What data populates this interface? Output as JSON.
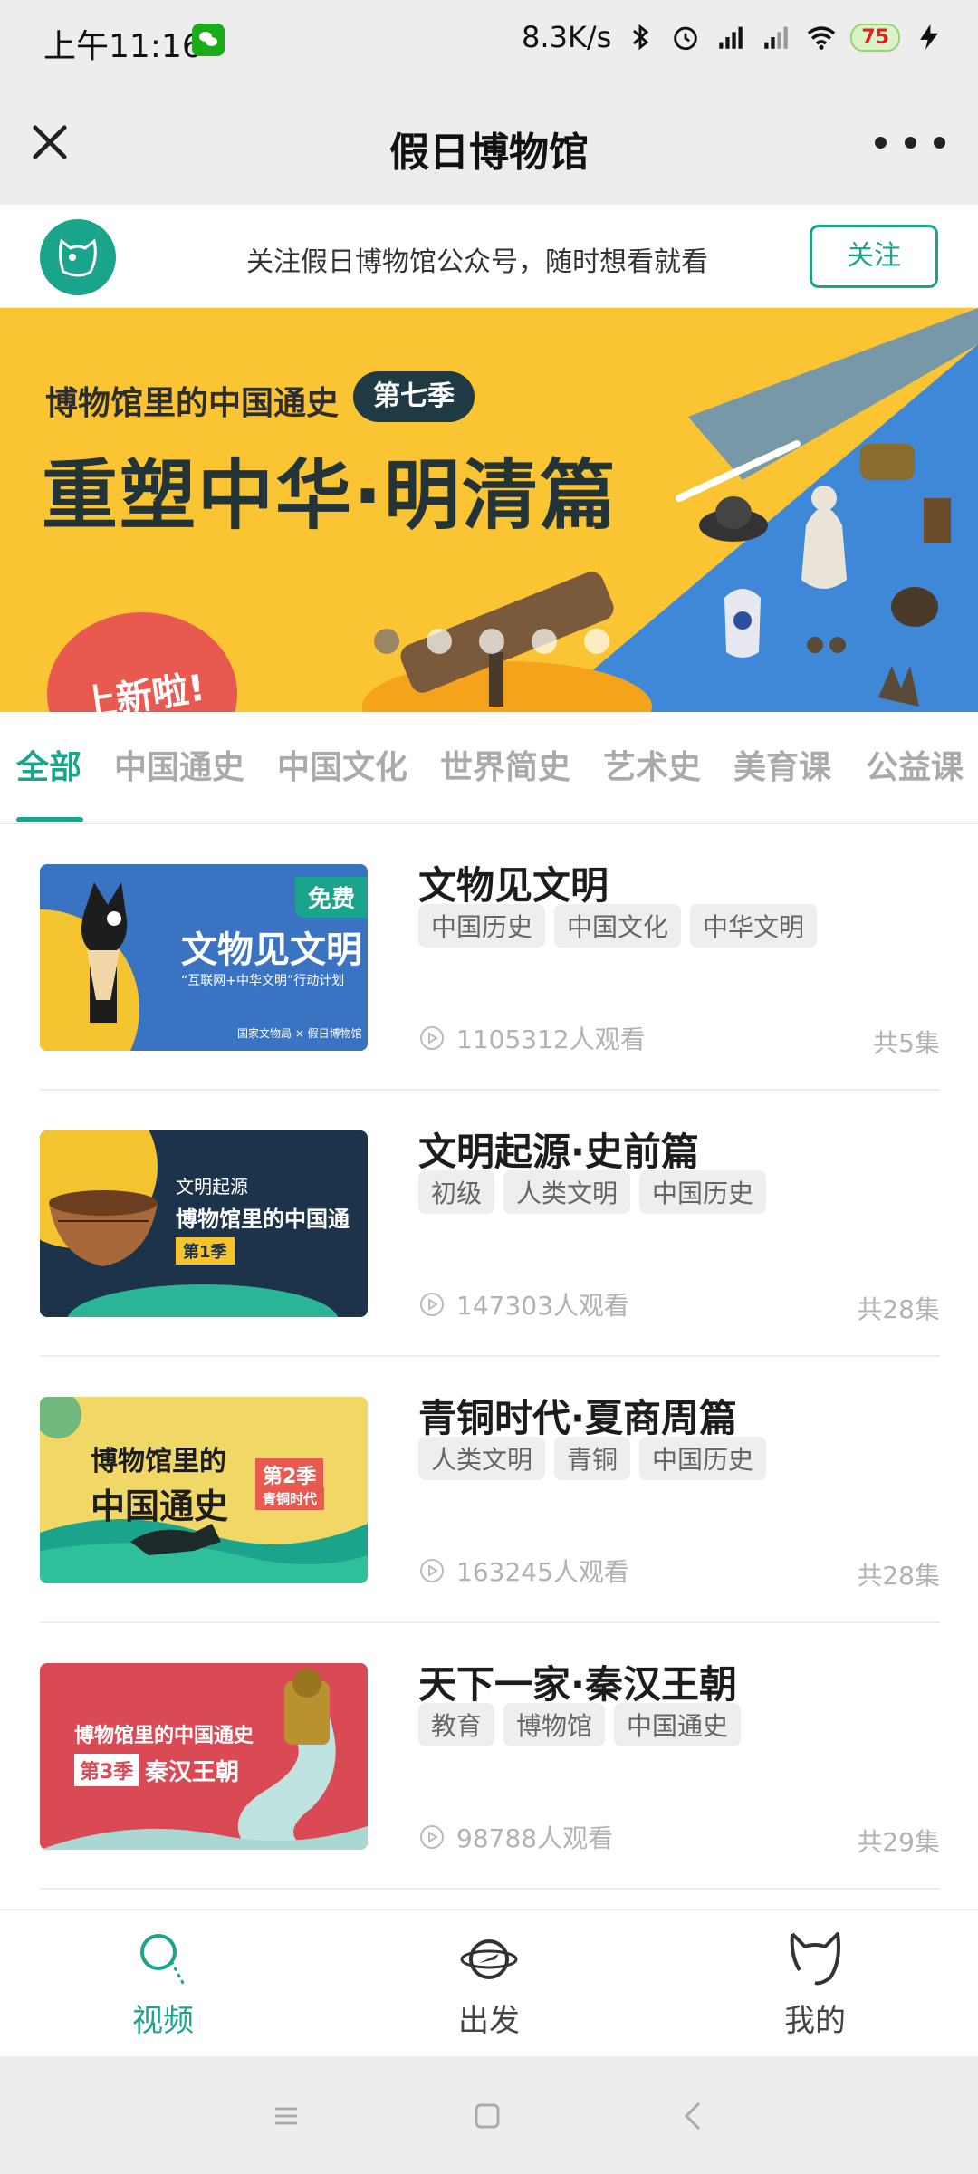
{
  "status_bar": {
    "time": "上午11:16",
    "speed": "8.3K/s",
    "battery": "75"
  },
  "header": {
    "title": "假日博物馆"
  },
  "follow_bar": {
    "text": "关注假日博物馆公众号，随时想看就看",
    "button": "关注"
  },
  "banner": {
    "subtitle": "博物馆里的中国通史",
    "season": "第七季",
    "title": "重塑中华·明清篇",
    "badge": "上新啦!",
    "slide_count": 5,
    "active_slide": 1
  },
  "tabs": [
    "全部",
    "中国通史",
    "中国文化",
    "世界简史",
    "艺术史",
    "美育课",
    "公益课"
  ],
  "active_tab": 0,
  "courses": [
    {
      "title": "文物见文明",
      "tags": [
        "中国历史",
        "中国文化",
        "中华文明"
      ],
      "views": "1105312人观看",
      "episodes": "共5集",
      "thumb": {
        "badge": "免费",
        "title": "文物见文明",
        "subtitle": "“互联网+中华文明”行动计划",
        "footer": "国家文物局 × 假日博物馆"
      }
    },
    {
      "title": "文明起源·史前篇",
      "tags": [
        "初级",
        "人类文明",
        "中国历史"
      ],
      "views": "147303人观看",
      "episodes": "共28集",
      "thumb": {
        "line1": "文明起源",
        "line2": "博物馆里的中国通史",
        "season": "第1季"
      }
    },
    {
      "title": "青铜时代·夏商周篇",
      "tags": [
        "人类文明",
        "青铜",
        "中国历史"
      ],
      "views": "163245人观看",
      "episodes": "共28集",
      "thumb": {
        "line1": "博物馆里的",
        "line2": "中国通史",
        "season": "第2季",
        "season_sub": "青铜时代"
      }
    },
    {
      "title": "天下一家·秦汉王朝",
      "tags": [
        "教育",
        "博物馆",
        "中国通史"
      ],
      "views": "98788人观看",
      "episodes": "共29集",
      "thumb": {
        "line1": "博物馆里的中国通史",
        "season": "第3季",
        "line2": "秦汉王朝"
      }
    }
  ],
  "bottom_nav": [
    {
      "label": "视频",
      "icon": "magnifier-icon",
      "active": true
    },
    {
      "label": "出发",
      "icon": "globe-plane-icon",
      "active": false
    },
    {
      "label": "我的",
      "icon": "cat-ears-icon",
      "active": false
    }
  ],
  "colors": {
    "accent": "#1aa48c",
    "banner_yellow": "#fbc433",
    "banner_blue": "#3f88d8"
  }
}
